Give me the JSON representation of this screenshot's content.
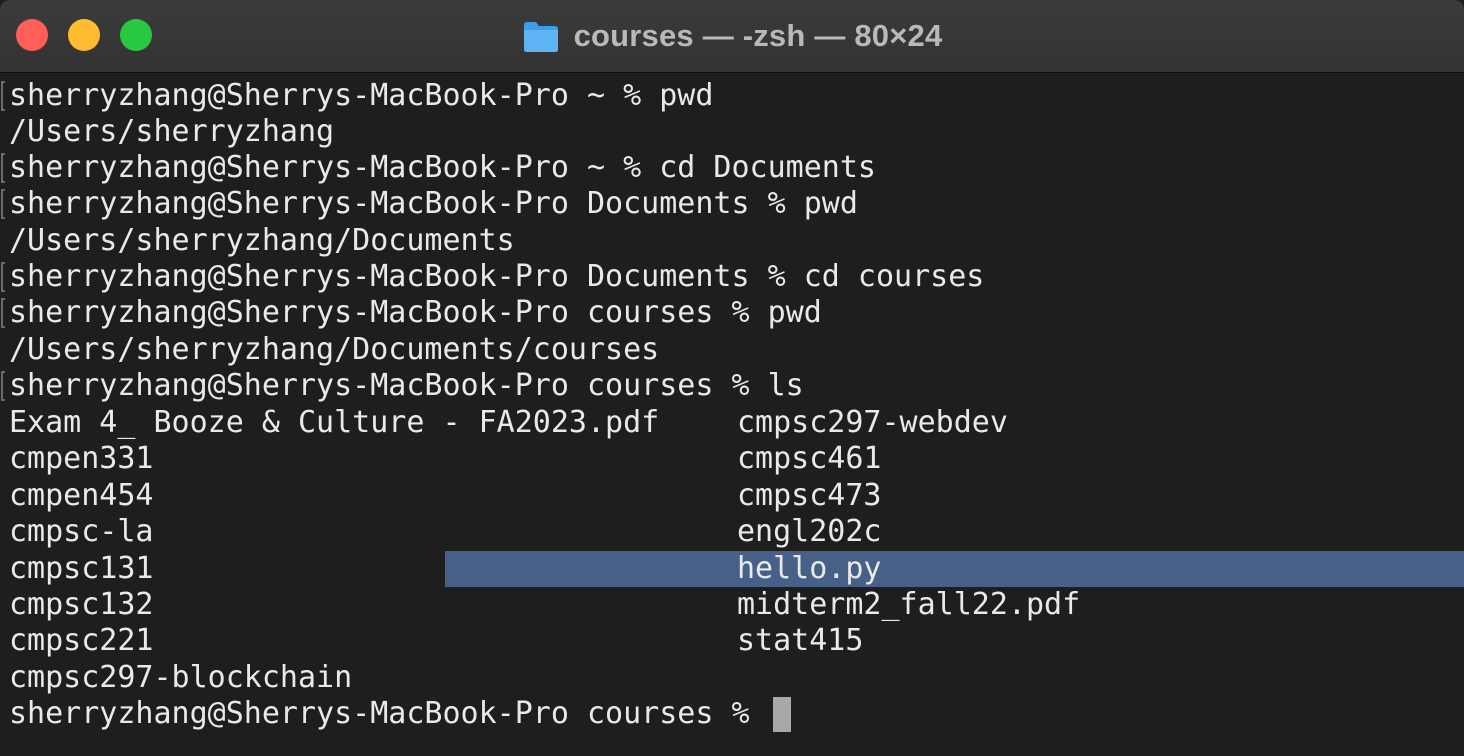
{
  "window": {
    "title": "courses — -zsh — 80×24",
    "colors": {
      "close": "#ff5f57",
      "minimize": "#febc2e",
      "zoom": "#28c840",
      "selection": "#466088",
      "background": "#1e1e1e",
      "foreground": "#e9e9e9"
    },
    "title_icon": "folder-icon"
  },
  "terminal": {
    "lines": [
      "sherryzhang@Sherrys-MacBook-Pro ~ % pwd",
      "/Users/sherryzhang",
      "sherryzhang@Sherrys-MacBook-Pro ~ % cd Documents",
      "sherryzhang@Sherrys-MacBook-Pro Documents % pwd",
      "/Users/sherryzhang/Documents",
      "sherryzhang@Sherrys-MacBook-Pro Documents % cd courses",
      "sherryzhang@Sherrys-MacBook-Pro courses % pwd",
      "/Users/sherryzhang/Documents/courses",
      "sherryzhang@Sherrys-MacBook-Pro courses % ls"
    ],
    "ls_left": [
      "Exam 4_ Booze & Culture - FA2023.pdf",
      "cmpen331",
      "cmpen454",
      "cmpsc-la",
      "cmpsc131",
      "cmpsc132",
      "cmpsc221",
      "cmpsc297-blockchain"
    ],
    "ls_right": [
      "cmpsc297-webdev",
      "cmpsc461",
      "cmpsc473",
      "engl202c",
      "hello.py",
      "midterm2_fall22.pdf",
      "stat415"
    ],
    "selected_item": "hello.py",
    "final_prompt": "sherryzhang@Sherrys-MacBook-Pro courses % "
  }
}
